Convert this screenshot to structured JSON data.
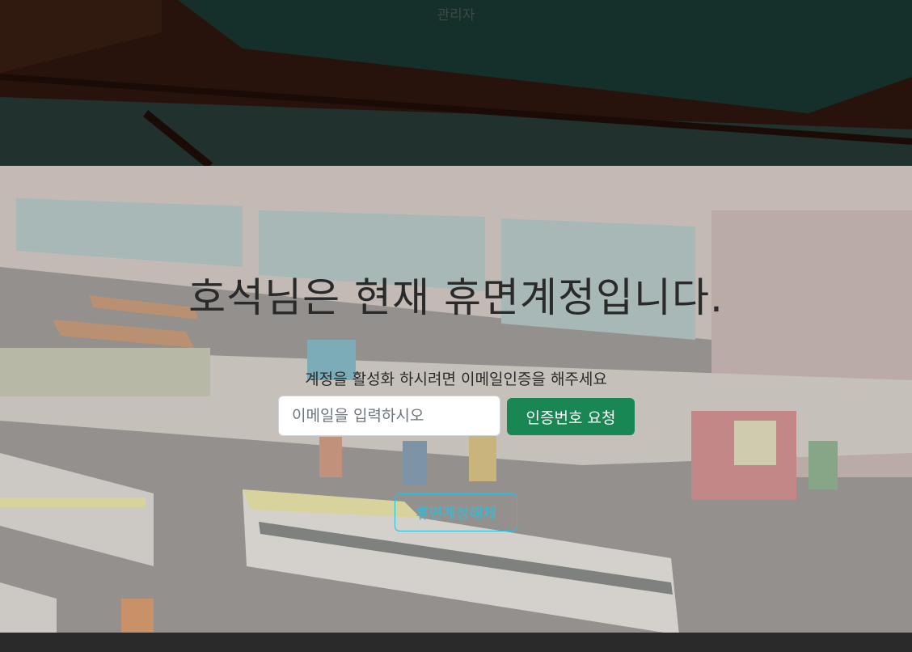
{
  "header": {
    "brand": "관리자"
  },
  "main": {
    "title": "호석님은 현재 휴면계정입니다.",
    "subtitle": "계정을 활성화 하시려면 이메일인증을 해주세요",
    "email_input": {
      "placeholder": "이메일을 입력하시오",
      "value": ""
    },
    "request_button_label": "인증번호 요청",
    "release_button_label": "휴면계정해제"
  },
  "colors": {
    "primary_success": "#198754",
    "outline_info": "#29c0df"
  }
}
